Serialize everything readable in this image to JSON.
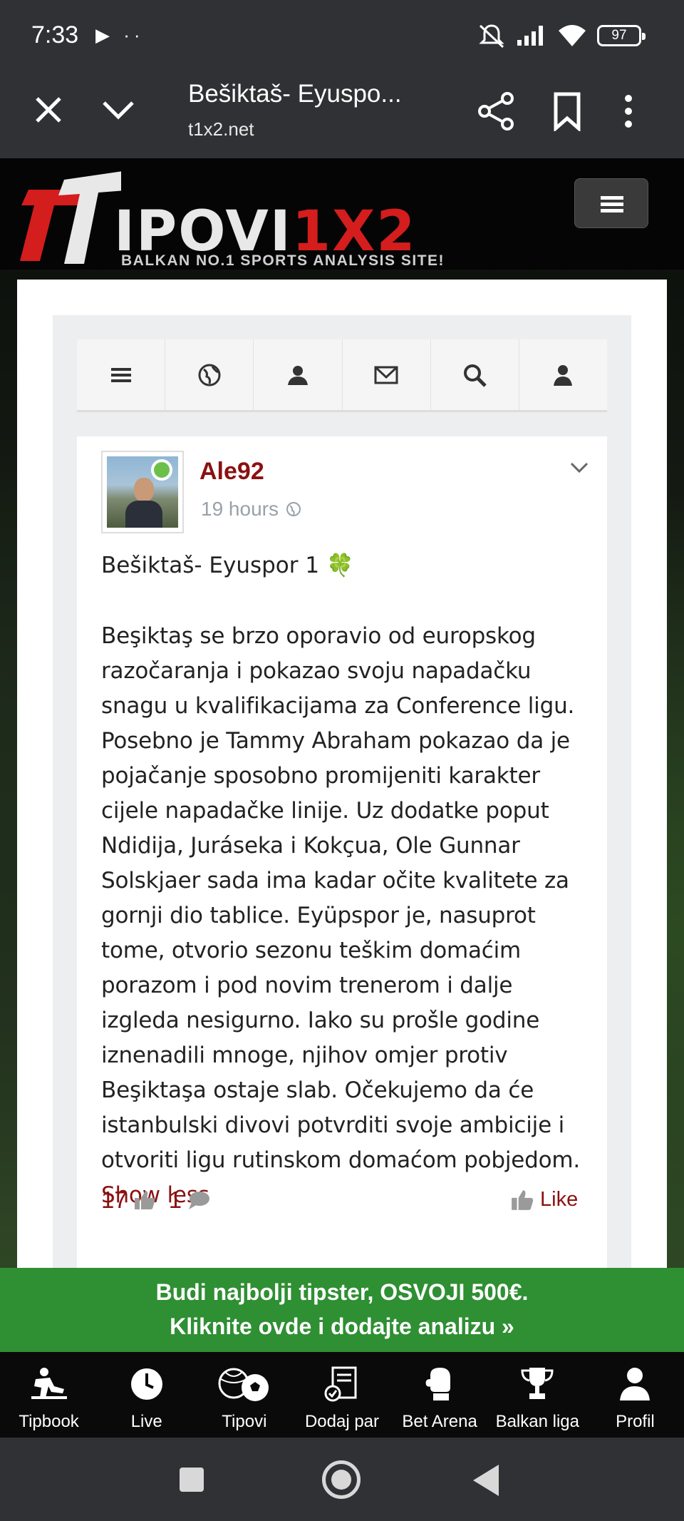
{
  "status": {
    "time": "7:33",
    "left_icons": "▶ ··",
    "battery": "97"
  },
  "browser": {
    "title": "Bešiktaš- Eyuspo...",
    "url": "t1x2.net"
  },
  "site": {
    "logo_main": "IPOVI",
    "logo_accent": "1X2",
    "logo_tagline": "BALKAN NO.1 SPORTS ANALYSIS SITE!"
  },
  "toolbar": {
    "items": [
      "menu-icon",
      "globe-icon",
      "users-icon",
      "mail-icon",
      "search-icon",
      "user-icon"
    ]
  },
  "post": {
    "username": "Ale92",
    "time": "19 hours",
    "title": "Bešiktaš- Eyuspor 1",
    "title_emoji": "🍀",
    "body": "Beşiktaş se brzo oporavio od europskog razočaranja i pokazao svoju napadačku snagu u kvalifikacijama za Conference ligu. Posebno je Tammy Abraham pokazao da je pojačanje sposobno promijeniti karakter cijele napadačke linije. Uz dodatke poput Ndidija, Juráseka i Kokçua, Ole Gunnar Solskjaer sada ima kadar očite kvalitete za gornji dio tablice. Eyüpspor je, nasuprot tome, otvorio sezonu teškim domaćim porazom i pod novim trenerom i dalje izgleda nesigurno. Iako su prošle godine iznenadili mnoge, njihov omjer protiv Beşiktaşa ostaje slab. Očekujemo da će istanbulski divovi potvrditi svoje ambicije i otvoriti ligu rutinskom domaćom pobjedom.",
    "show_less": "Show less",
    "likes": "17",
    "comments": "1",
    "like_label": "Like"
  },
  "promo": {
    "line1": "Budi najbolji tipster, OSVOJI 500€.",
    "line2": "Kliknite ovde i dodajte analizu »"
  },
  "bottom_nav": [
    {
      "label": "Tipbook",
      "icon": "tipbook-icon"
    },
    {
      "label": "Live",
      "icon": "clock-icon"
    },
    {
      "label": "Tipovi",
      "icon": "balls-icon"
    },
    {
      "label": "Dodaj par",
      "icon": "ticket-icon"
    },
    {
      "label": "Bet Arena",
      "icon": "glove-icon"
    },
    {
      "label": "Balkan liga",
      "icon": "trophy-icon"
    },
    {
      "label": "Profil",
      "icon": "profile-icon"
    }
  ],
  "colors": {
    "brand_red": "#8b1111",
    "promo_green": "#2f8f33",
    "chrome_gray": "#303134"
  }
}
